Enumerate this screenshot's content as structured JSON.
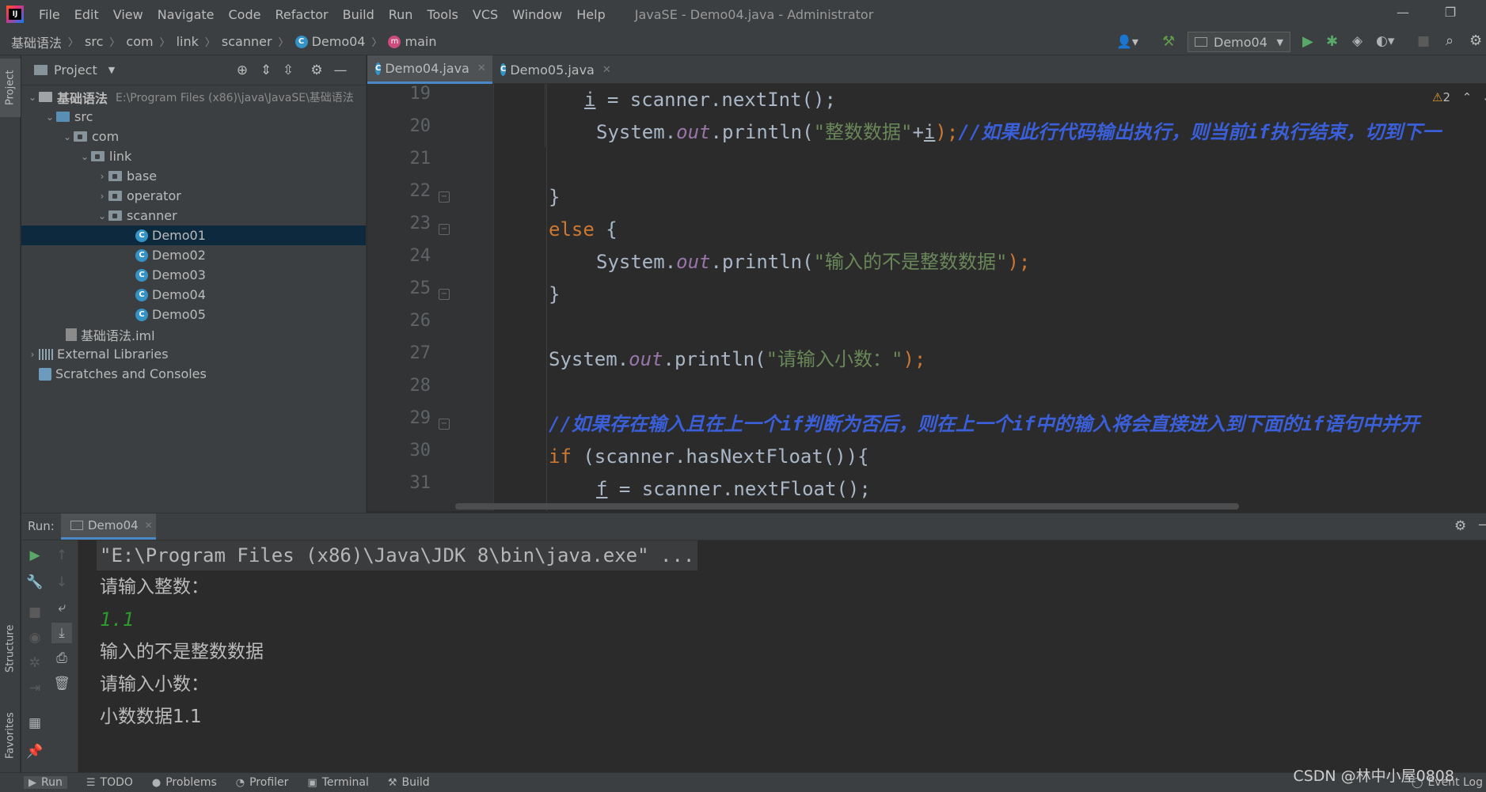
{
  "window": {
    "title": "JavaSE - Demo04.java - Administrator",
    "menus": [
      "File",
      "Edit",
      "View",
      "Navigate",
      "Code",
      "Refactor",
      "Build",
      "Run",
      "Tools",
      "VCS",
      "Window",
      "Help"
    ]
  },
  "breadcrumb": {
    "items": [
      "基础语法",
      "src",
      "com",
      "link",
      "scanner",
      "Demo04",
      "main"
    ]
  },
  "toolbar": {
    "run_config": "Demo04"
  },
  "left_stripe": {
    "project_tab": "Project",
    "structure_tab": "Structure",
    "favorites_tab": "Favorites"
  },
  "project_panel": {
    "title": "Project",
    "tree": {
      "root_name": "基础语法",
      "root_path": "E:\\Program Files (x86)\\java\\JavaSE\\基础语法",
      "src": "src",
      "com": "com",
      "link": "link",
      "base": "base",
      "operator": "operator",
      "scanner": "scanner",
      "classes": [
        "Demo01",
        "Demo02",
        "Demo03",
        "Demo04",
        "Demo05"
      ],
      "iml": "基础语法.iml",
      "ext_libs": "External Libraries",
      "scratches": "Scratches and Consoles"
    }
  },
  "editor": {
    "tabs": [
      {
        "label": "Demo04.java",
        "active": true
      },
      {
        "label": "Demo05.java",
        "active": false
      }
    ],
    "warnings_count": "2",
    "line_numbers": [
      "19",
      "20",
      "21",
      "22",
      "23",
      "24",
      "25",
      "26",
      "27",
      "28",
      "29",
      "30",
      "31"
    ],
    "code": {
      "l19_var": "i",
      "l19_rest": " = scanner.nextInt();",
      "l20_a": "System.",
      "l20_out": "out",
      "l20_b": ".println(",
      "l20_str": "\"整数数据\"",
      "l20_c": "+",
      "l20_var": "i",
      "l20_d": ");",
      "l20_comment": "//如果此行代码输出执行，则当前if执行结束，切到下一",
      "l22": "}",
      "l23_kw": "else",
      "l23_rest": " {",
      "l24_a": "System.",
      "l24_out": "out",
      "l24_b": ".println(",
      "l24_str": "\"输入的不是整数数据\"",
      "l24_c": ");",
      "l25": "}",
      "l27_a": "System.",
      "l27_out": "out",
      "l27_b": ".println(",
      "l27_str": "\"请输入小数：\"",
      "l27_c": ");",
      "l29_comment": "//如果存在输入且在上一个if判断为否后，则在上一个if中的输入将会直接进入到下面的if语句中并开",
      "l30_kw": "if",
      "l30_rest": " (scanner.hasNextFloat()){",
      "l31_var": "f",
      "l31_rest": " = scanner.nextFloat();"
    }
  },
  "run_panel": {
    "label": "Run:",
    "tab": "Demo04",
    "console": [
      "\"E:\\Program Files (x86)\\Java\\JDK 8\\bin\\java.exe\" ...",
      "请输入整数：",
      "1.1",
      "输入的不是整数数据",
      "请输入小数：",
      "小数数据1.1"
    ]
  },
  "bottom_tabs": [
    "Run",
    "TODO",
    "Problems",
    "Profiler",
    "Terminal",
    "Build"
  ],
  "event_log": "Event Log",
  "watermark": "CSDN @林中小屋0808",
  "colors": {
    "keyword": "#cc7832",
    "string": "#6a8759",
    "field": "#9876aa",
    "comment": "#3b5fd9",
    "input_text": "#2d9a2d",
    "selection": "#0d293e"
  }
}
